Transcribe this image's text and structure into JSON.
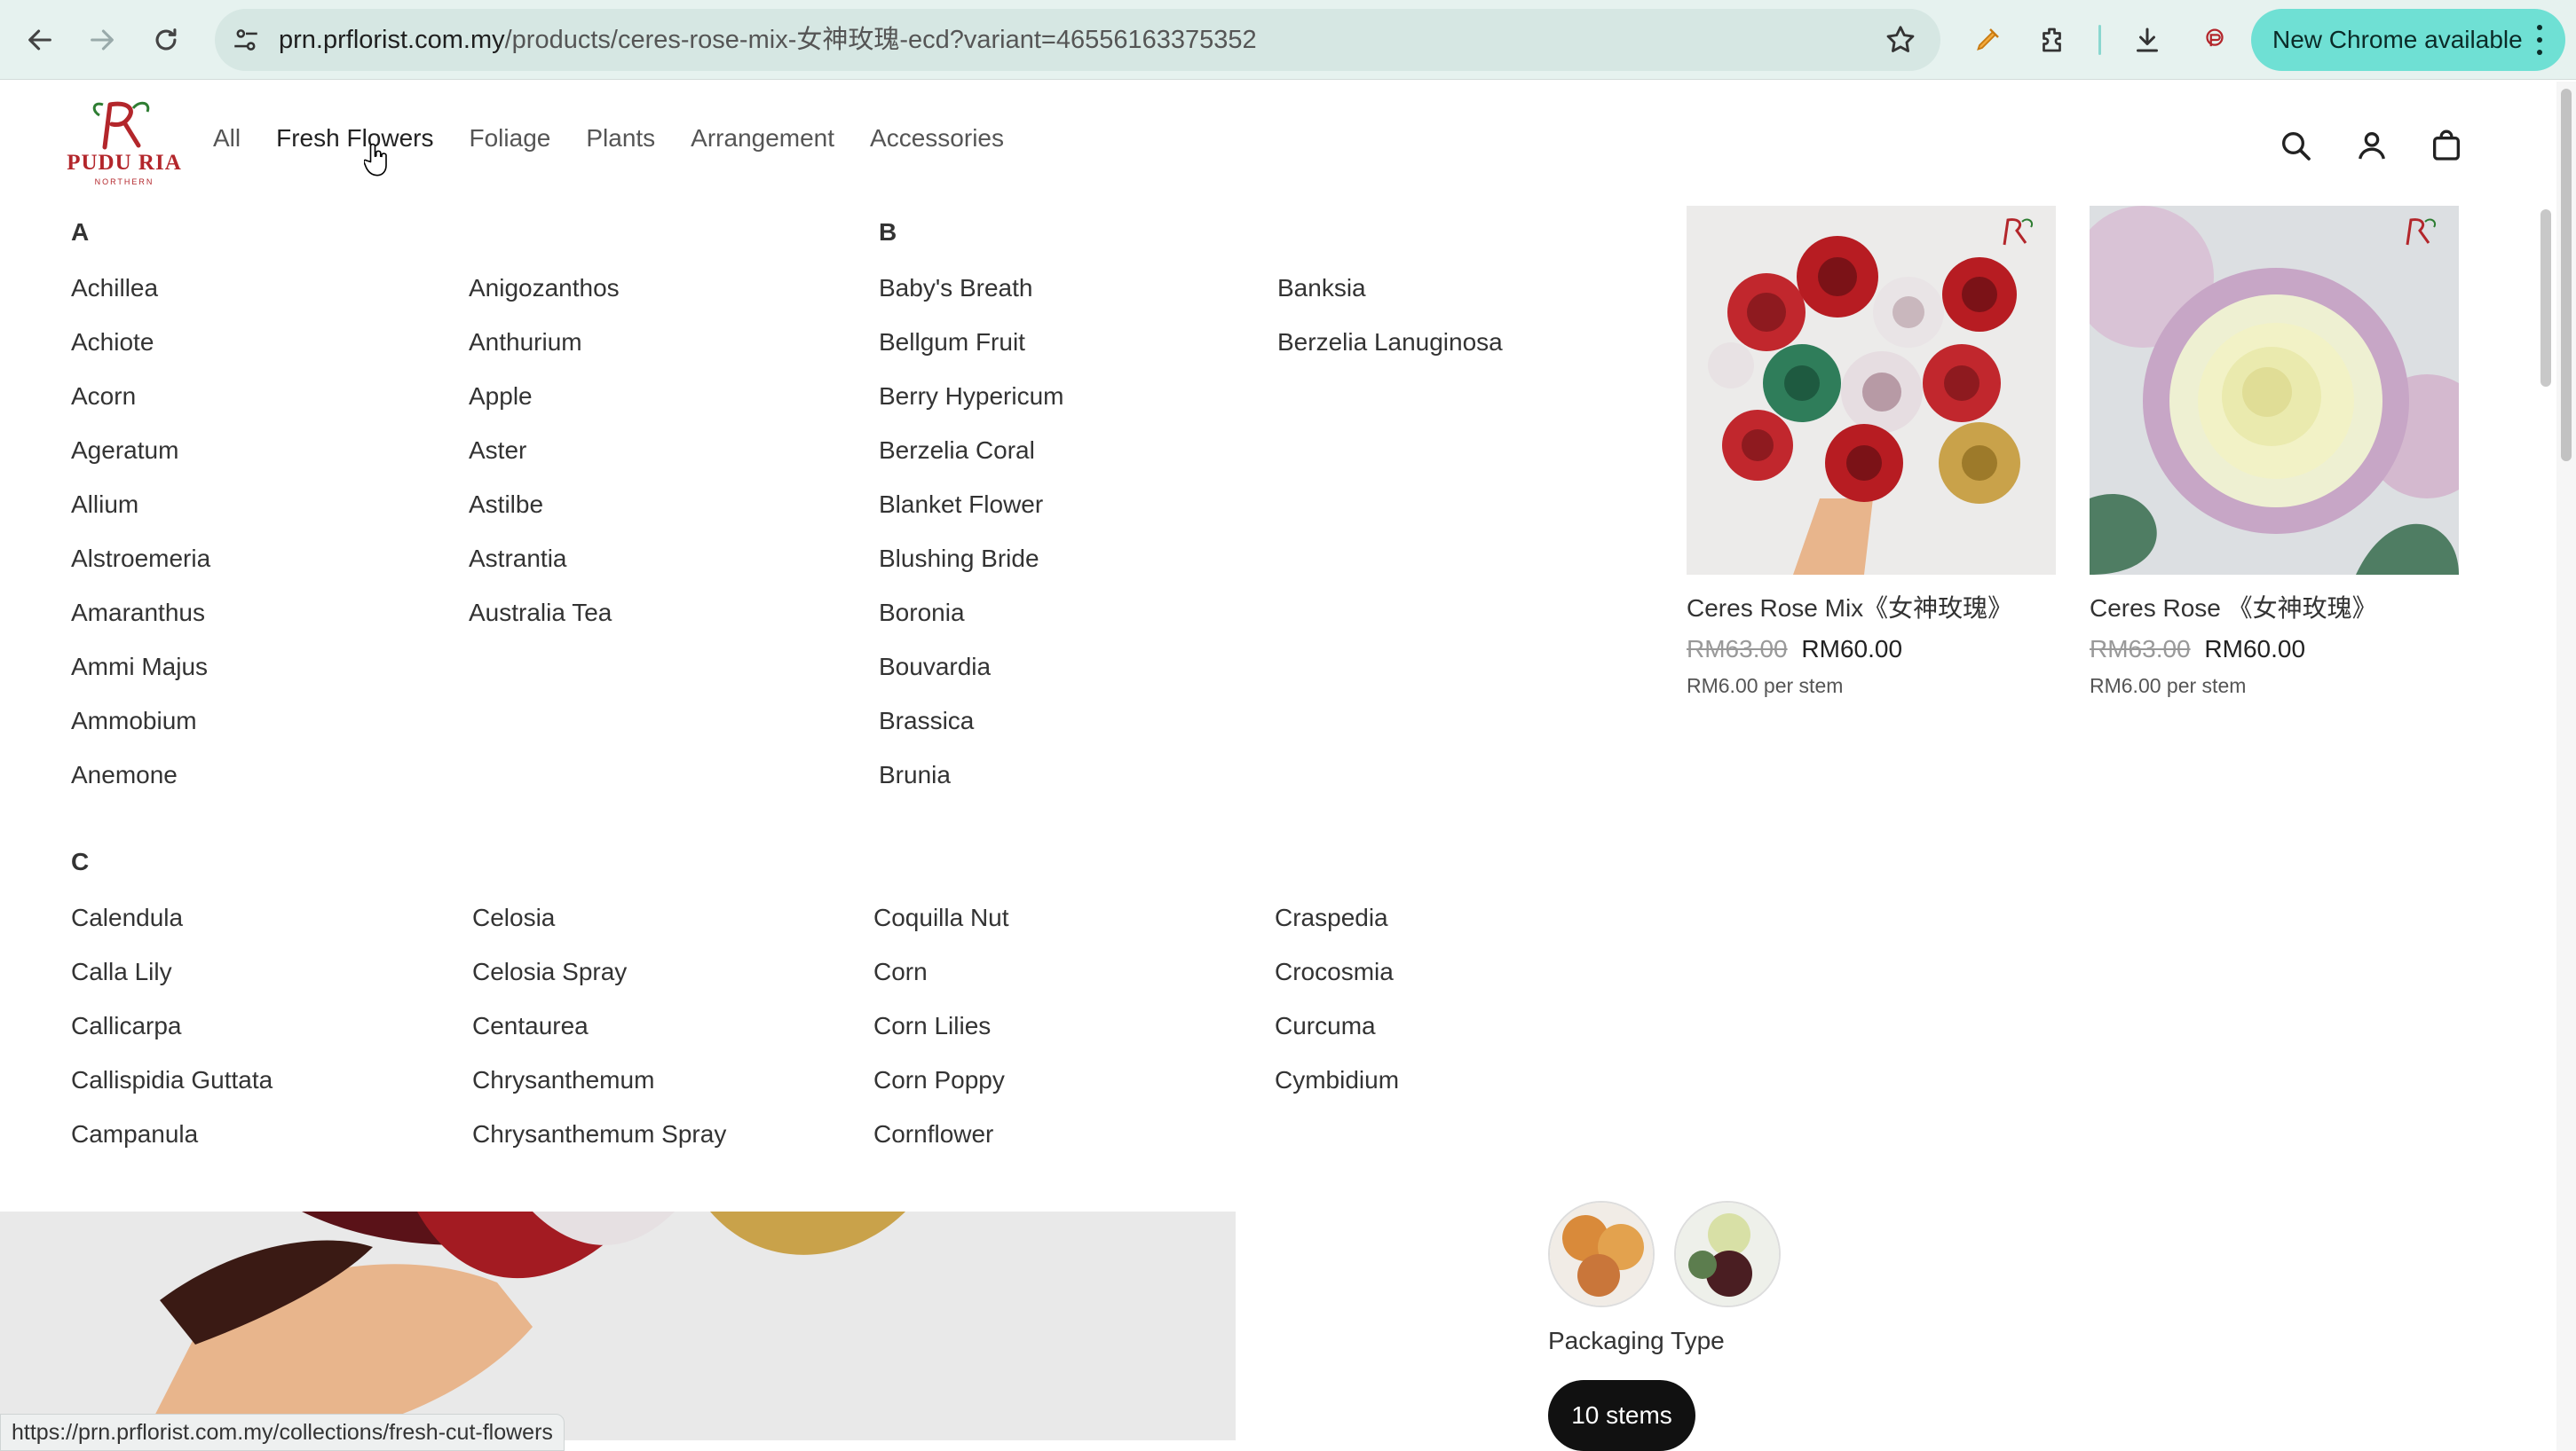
{
  "browser": {
    "url_host": "prn.prflorist.com.my",
    "url_path": "/products/ceres-rose-mix-女神玫瑰-ecd?variant=46556163375352",
    "update_label": "New Chrome available",
    "status_url": "https://prn.prflorist.com.my/collections/fresh-cut-flowers"
  },
  "header": {
    "logo_name": "PUDU RIA",
    "logo_sub": "NORTHERN",
    "nav": [
      "All",
      "Fresh Flowers",
      "Foliage",
      "Plants",
      "Arrangement",
      "Accessories"
    ]
  },
  "mega_menu": {
    "groups": [
      {
        "letter": "A",
        "columns": [
          [
            "Achillea",
            "Achiote",
            "Acorn",
            "Ageratum",
            "Allium",
            "Alstroemeria",
            "Amaranthus",
            "Ammi Majus",
            "Ammobium",
            "Anemone"
          ],
          [
            "Anigozanthos",
            "Anthurium",
            "Apple",
            "Aster",
            "Astilbe",
            "Astrantia",
            "Australia Tea"
          ]
        ]
      },
      {
        "letter": "B",
        "columns": [
          [
            "Baby's Breath",
            "Bellgum Fruit",
            "Berry Hypericum",
            "Berzelia Coral",
            "Blanket Flower",
            "Blushing Bride",
            "Boronia",
            "Bouvardia",
            "Brassica",
            "Brunia"
          ],
          [
            "Banksia",
            "Berzelia Lanuginosa"
          ]
        ]
      },
      {
        "letter": "C",
        "columns": [
          [
            "Calendula",
            "Calla Lily",
            "Callicarpa",
            "Callispidia Guttata",
            "Campanula"
          ],
          [
            "Celosia",
            "Celosia Spray",
            "Centaurea",
            "Chrysanthemum",
            "Chrysanthemum Spray"
          ],
          [
            "Coquilla Nut",
            "Corn",
            "Corn Lilies",
            "Corn Poppy",
            "Cornflower"
          ],
          [
            "Craspedia",
            "Crocosmia",
            "Curcuma",
            "Cymbidium"
          ]
        ]
      }
    ],
    "featured": [
      {
        "title": "Ceres Rose Mix《女神玫瑰》",
        "old_price": "RM63.00",
        "price": "RM60.00",
        "unit": "RM6.00 per stem"
      },
      {
        "title": "Ceres Rose 《女神玫瑰》",
        "old_price": "RM63.00",
        "price": "RM60.00",
        "unit": "RM6.00 per stem"
      }
    ]
  },
  "product": {
    "packaging_label": "Packaging Type",
    "packaging_selected": "10 stems"
  },
  "colors": {
    "brand_red": "#b3262b",
    "chrome_bg": "#e6f2ef",
    "update_pill": "#6fe0d4"
  }
}
